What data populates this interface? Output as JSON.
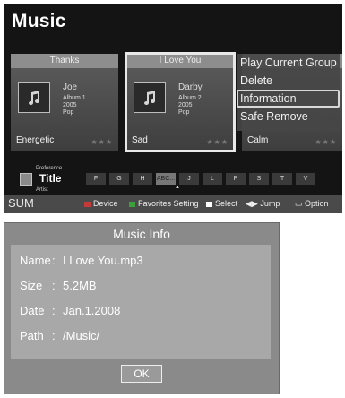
{
  "app": {
    "title": "Music"
  },
  "cards": [
    {
      "title": "Thanks",
      "artist": "Joe",
      "album": "Album 1",
      "year": "2005",
      "genre": "Pop",
      "mood": "Energetic",
      "stars": "★★★",
      "selected": false
    },
    {
      "title": "I Love You",
      "artist": "Darby",
      "album": "Album 2",
      "year": "2005",
      "genre": "Pop",
      "mood": "Sad",
      "stars": "★★★",
      "selected": true
    },
    {
      "title": "",
      "artist": "",
      "album": "",
      "year": "",
      "genre": "",
      "mood": "Calm",
      "stars": "★★★",
      "selected": false
    }
  ],
  "context_menu": {
    "items": [
      "Play Current Group",
      "Delete",
      "Information",
      "Safe Remove"
    ],
    "focused": "Information"
  },
  "sort_bar": {
    "above": "Preference",
    "title": "Title",
    "below": "Artist",
    "letters": [
      "F",
      "G",
      "H",
      "ABC...",
      "J",
      "L",
      "P",
      "S",
      "T",
      "V"
    ],
    "current": "ABC..."
  },
  "footer": {
    "sum": "SUM",
    "device": "Device",
    "favorites": "Favorites Setting",
    "select": "Select",
    "jump": "Jump",
    "option": "Option"
  },
  "dialog": {
    "title": "Music Info",
    "rows": [
      {
        "label": "Name",
        "value": "I Love You.mp3"
      },
      {
        "label": "Size",
        "value": "5.2MB"
      },
      {
        "label": "Date",
        "value": "Jan.1.2008"
      },
      {
        "label": "Path",
        "value": "/Music/"
      }
    ],
    "ok_label": "OK"
  },
  "colors": {
    "screen_bg": "#141414",
    "dialog_bg": "#8a8a8a",
    "dialog_body": "#a8a8a8",
    "menu_bg": "#464646"
  },
  "icons": [
    "music-note-icon",
    "sort-icon",
    "jump-icon",
    "option-icon"
  ]
}
